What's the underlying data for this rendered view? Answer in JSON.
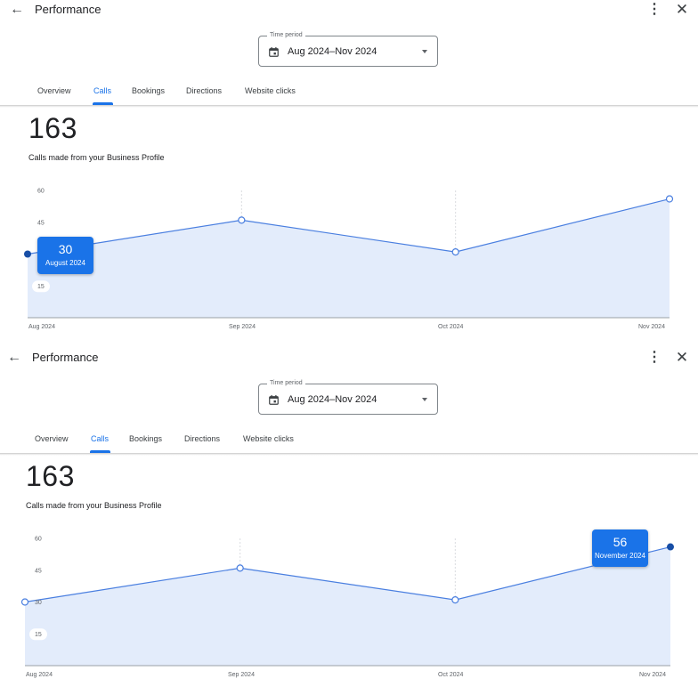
{
  "header": {
    "back_icon": "arrow-back-icon",
    "title": "Performance",
    "more_icon": "more-vert-icon",
    "close_icon": "close-icon"
  },
  "time_period": {
    "label": "Time period",
    "value": "Aug 2024–Nov 2024",
    "icon": "calendar-icon"
  },
  "tabs": [
    {
      "label": "Overview",
      "active": false
    },
    {
      "label": "Calls",
      "active": true
    },
    {
      "label": "Bookings",
      "active": false
    },
    {
      "label": "Directions",
      "active": false
    },
    {
      "label": "Website clicks",
      "active": false
    }
  ],
  "metric": {
    "value": "163",
    "label": "Calls made from your Business Profile"
  },
  "colors": {
    "accent": "#1a73e8",
    "area_fill": "#e3ecfb",
    "line": "#4a7fe0"
  },
  "chart_data": {
    "type": "area",
    "x": [
      "Aug 2024",
      "Sep 2024",
      "Oct 2024",
      "Nov 2024"
    ],
    "series": [
      {
        "values": [
          30,
          46,
          31,
          56
        ]
      }
    ],
    "y_ticks": [
      "60",
      "45",
      "30",
      "15"
    ],
    "ylim": [
      0,
      60
    ],
    "grid": "vertical dashed"
  },
  "panels": [
    {
      "tooltip": {
        "value": "30",
        "label": "August 2024",
        "index": 0
      }
    },
    {
      "tooltip": {
        "value": "56",
        "label": "November 2024",
        "index": 3
      }
    }
  ]
}
